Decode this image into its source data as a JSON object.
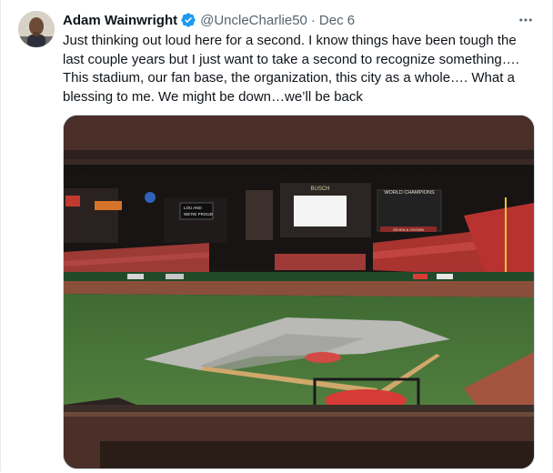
{
  "tweet": {
    "author_name": "Adam Wainwright",
    "handle": "@UncleCharlie50",
    "separator": "·",
    "date": "Dec 6",
    "text": "Just thinking out loud here for a second.  I know things have been tough the last couple years but I just want to take a second to recognize something…. This stadium, our fan base, the organization, this city as a whole…. What a blessing to me.  We might be down…we’ll be back",
    "verified_icon": "verified-badge-icon",
    "more_icon": "more-horizontal-icon",
    "avatar": "author-avatar"
  },
  "media": {
    "signs": {
      "world_champions": "WORLD CHAMPIONS",
      "busch_scoreboard": "BUSCH",
      "lou_sign_line1": "LOU AND",
      "lou_sign_line2": "WE'RE PROUD",
      "seven_crown": "SEVEN & CROWN"
    }
  },
  "colors": {
    "accent_blue": "#1d9bf0",
    "text_primary": "#0f1419",
    "text_secondary": "#536471",
    "seats_red": "#b8332f",
    "turf_green": "#4f7f3e"
  }
}
